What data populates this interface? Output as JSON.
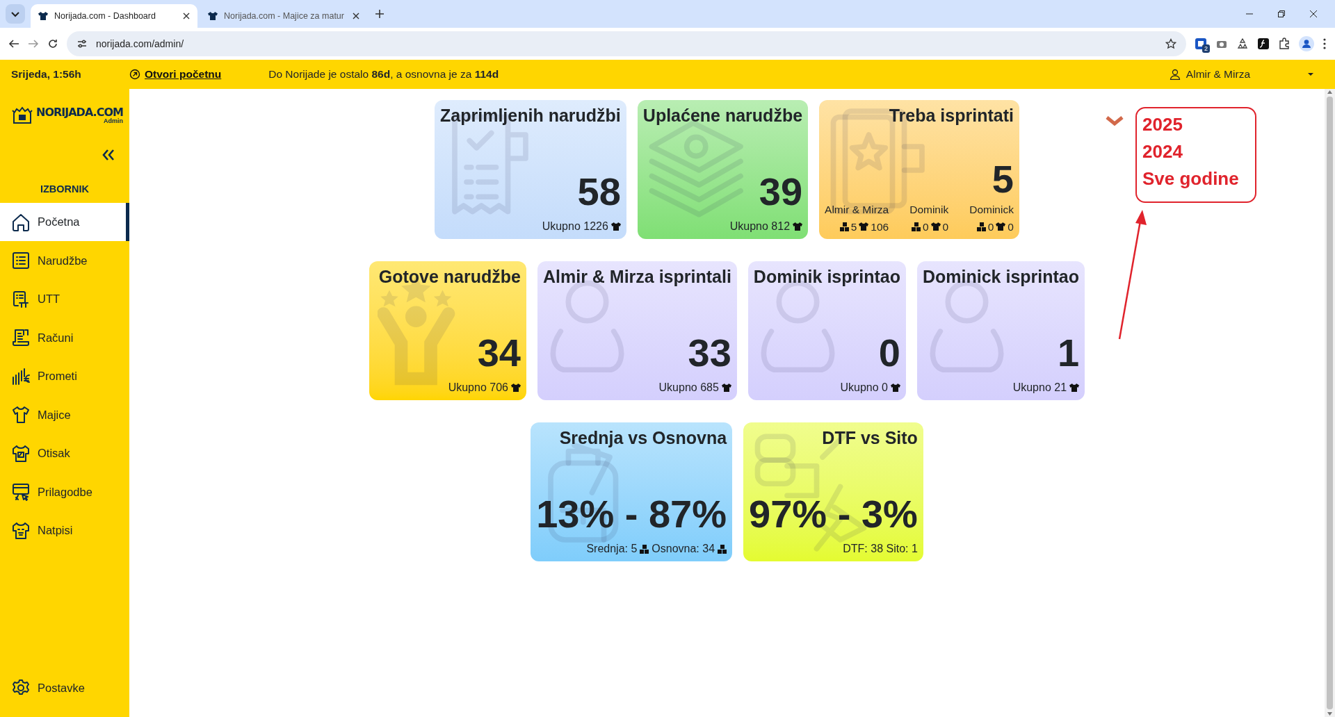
{
  "browser": {
    "tabs": [
      {
        "title": "Norijada.com - Dashboard",
        "selected": true
      },
      {
        "title": "Norijada.com - Majice za matur",
        "selected": false
      }
    ],
    "address": "norijada.com/admin/",
    "extension_badge": "2"
  },
  "topbar": {
    "date": "Srijeda, 1:56h",
    "home_link": "Otvori početnu",
    "countdown": "Do Norijade je ostalo **86d**, a osnovna je za **114d**",
    "user": "Almir & Mirza"
  },
  "sidebar": {
    "logo": "NORIJADA.COM",
    "logo_sub": "Admin",
    "heading": "IZBORNIK",
    "items": [
      {
        "label": "Početna",
        "selected": true
      },
      {
        "label": "Narudžbe",
        "selected": false
      },
      {
        "label": "UTT",
        "selected": false
      },
      {
        "label": "Računi",
        "selected": false
      },
      {
        "label": "Prometi",
        "selected": false
      },
      {
        "label": "Majice",
        "selected": false
      },
      {
        "label": "Otisak",
        "selected": false
      },
      {
        "label": "Prilagodbe",
        "selected": false
      },
      {
        "label": "Natpisi",
        "selected": false
      }
    ],
    "footer_item": "Postavke"
  },
  "card_rows": [
    {
      "cards": [
        {
          "kind": "total",
          "title": "Zaprimljenih narudžbi",
          "value": "58",
          "total": "Ukupno 1226",
          "color": "#c4dcfb"
        },
        {
          "kind": "total",
          "title": "Uplaćene narudžbe",
          "value": "39",
          "total": "Ukupno 812",
          "color": "#7fdf74"
        },
        {
          "kind": "breakdown",
          "title": "Treba isprintati",
          "value": "5",
          "color": "#fecb5a",
          "breakdown": [
            {
              "name": "Almir & Mirza",
              "boxes": "5",
              "shirts": "106"
            },
            {
              "name": "Dominik",
              "boxes": "0",
              "shirts": "0"
            },
            {
              "name": "Dominick",
              "boxes": "0",
              "shirts": "0"
            }
          ]
        }
      ]
    },
    {
      "cards": [
        {
          "kind": "total",
          "title": "Gotove narudžbe",
          "value": "34",
          "total": "Ukupno 706",
          "color": "#ffd500"
        },
        {
          "kind": "total",
          "title": "Almir & Mirza isprintali",
          "value": "33",
          "total": "Ukupno 685",
          "color": "#d4cffd"
        },
        {
          "kind": "total",
          "title": "Dominik isprintao",
          "value": "0",
          "total": "Ukupno 0",
          "color": "#d4cffd"
        },
        {
          "kind": "total",
          "title": "Dominick isprintao",
          "value": "1",
          "total": "Ukupno 21",
          "color": "#d4cffd"
        }
      ]
    },
    {
      "cards": [
        {
          "kind": "ratio",
          "title": "Srednja vs Osnovna",
          "value": "13% - 87%",
          "color": "#7fcdfb",
          "parts": [
            {
              "text": "Srednja: 5",
              "boxes_icon": true
            },
            {
              "text": "Osnovna: 34",
              "boxes_icon": true
            }
          ]
        },
        {
          "kind": "ratio",
          "title": "DTF vs Sito",
          "value": "97% - 3%",
          "color": "#e4fb30",
          "parts": [
            {
              "text": "DTF: 38 Sito: 1",
              "boxes_icon": false
            }
          ]
        }
      ]
    }
  ],
  "annotation": {
    "items": [
      "2025",
      "2024",
      "Sve godine"
    ]
  }
}
